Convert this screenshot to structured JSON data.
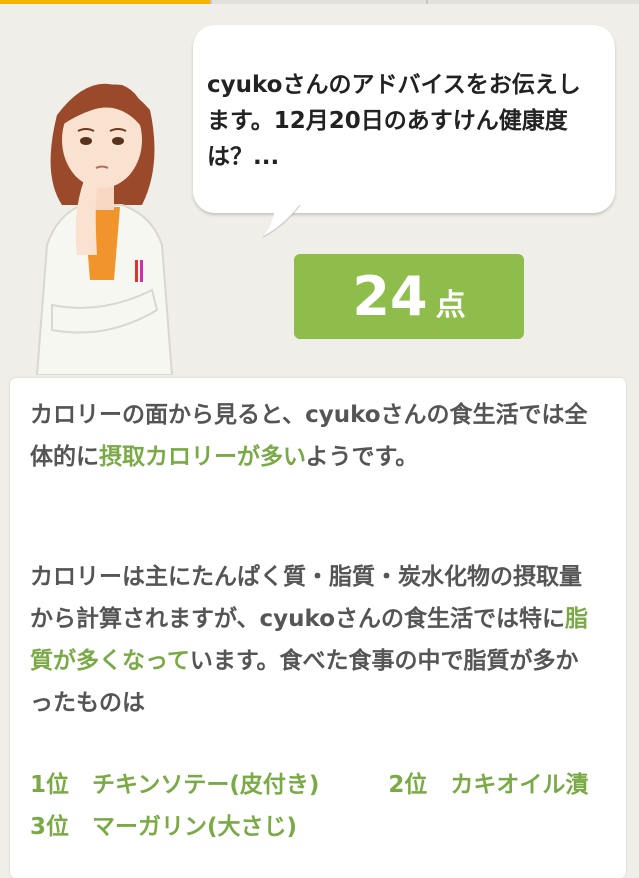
{
  "colors": {
    "accent_tab": "#f2b400",
    "score_bg": "#8fbd4b",
    "highlight": "#7aaa45",
    "text": "#555555",
    "bg": "#f0eee8"
  },
  "advisor": {
    "icon": "doctor-thinking-illustration",
    "message": "cyukoさんのアドバイスをお伝えします。12月20日のあすけん健康度は？..."
  },
  "score": {
    "value": "24",
    "unit": "点"
  },
  "advice": {
    "p1_a": "カロリーの面から見ると、cyukoさんの食生活では全体的に",
    "p1_hl": "摂取カロリーが多い",
    "p1_b": "ようです。",
    "p2_a": "カロリーは主にたんぱく質・脂質・炭水化物の摂取量から計算されますが、cyukoさんの食生活では特に",
    "p2_hl": "脂質が多くなって",
    "p2_b": "います。食べた食事の中で脂質が多かったものは",
    "rankings": [
      {
        "rank": "1位",
        "food": "チキンソテー(皮付き)"
      },
      {
        "rank": "2位",
        "food": "カキオイル漬"
      },
      {
        "rank": "3位",
        "food": "マーガリン(大さじ)"
      }
    ]
  }
}
